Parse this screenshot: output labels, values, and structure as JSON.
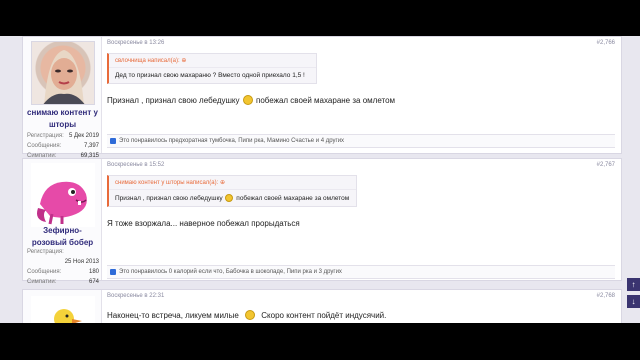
{
  "posts": [
    {
      "user": {
        "name": "снимаю контент у шторы",
        "stats": [
          {
            "k": "Регистрация:",
            "v": "5 Дек 2019"
          },
          {
            "k": "Сообщения:",
            "v": "7,397"
          },
          {
            "k": "Симпатии:",
            "v": "69,315"
          }
        ]
      },
      "date": "Воскресенье в 13:26",
      "num": "#2,766",
      "quote_author": "свлочнища написал(а):",
      "quote_text": "Дед то признал свою махараню ? Вместо одной приехало 1,5 !",
      "message": "Признал , признал свою лебедушку",
      "message_tail": "побежал своей махаране за омлетом",
      "likes": "Это понравилось предхоратная тумбочка, Пипи рка, Мамино Счастье и 4 других"
    },
    {
      "user": {
        "name": "Зефирно-розовый бобер",
        "stats": [
          {
            "k": "Регистрация:",
            "v": ""
          },
          {
            "k": "",
            "v": "25 Ноя 2013"
          },
          {
            "k": "Сообщения:",
            "v": "180"
          },
          {
            "k": "Симпатии:",
            "v": "674"
          }
        ]
      },
      "date": "Воскресенье в 15:52",
      "num": "#2,767",
      "quote_author": "снимаю контент у шторы написал(а):",
      "quote_text": "Признал , признал свою лебедушку",
      "quote_tail": "побежал своей махаране за омлетом",
      "message": "Я тоже взоржала... наверное побежал прорыдаться",
      "likes": "Это понравилось 0 калорий если что, Бабочка в шоколаде, Пипи рка и 3 других"
    },
    {
      "date": "Воскресенье в 22:31",
      "num": "#2,768",
      "message": "Наконец-то встреча, ликуем милые",
      "message_tail": "Скоро контент пойдёт индусячий."
    }
  ],
  "scroll": {
    "up": "↑",
    "down": "↓"
  }
}
